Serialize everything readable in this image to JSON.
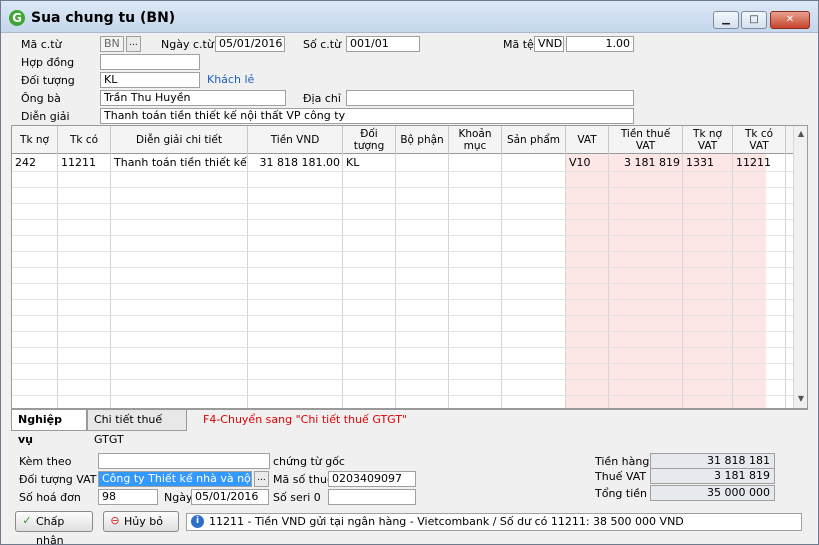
{
  "window": {
    "title": "Sua chung tu (BN)",
    "controls": {
      "minimize": "▁",
      "maximize": "□",
      "close": "✕"
    }
  },
  "header": {
    "ma_ct_label": "Mã c.từ",
    "ma_ct_value": "BN",
    "ma_ct_btn": "...",
    "ngay_ct_label": "Ngày c.từ",
    "ngay_ct_value": "05/01/2016",
    "so_ct_label": "Số c.từ",
    "so_ct_value": "001/01",
    "ma_te_label": "Mã tệ",
    "ma_te_value": "VND",
    "ty_gia_value": "1.00",
    "hop_dong_label": "Hợp đồng",
    "hop_dong_value": "",
    "doi_tuong_label": "Đối tượng",
    "doi_tuong_value": "KL",
    "doi_tuong_link": "Khách lẻ",
    "ong_ba_label": "Ông bà",
    "ong_ba_value": "Trần Thu Huyền",
    "dia_chi_label": "Địa chỉ",
    "dia_chi_value": "",
    "dien_giai_label": "Diễn giải",
    "dien_giai_value": "Thanh toán tiền thiết kế nội thất VP công ty"
  },
  "grid": {
    "columns": [
      "Tk nợ",
      "Tk có",
      "Diễn giải chi tiết",
      "Tiền VND",
      "Đối tượng",
      "Bộ phận",
      "Khoản mục",
      "Sản phẩm",
      "VAT",
      "Tiền thuế VAT",
      "Tk nợ VAT",
      "Tk có VAT"
    ],
    "rows": [
      [
        "242",
        "11211",
        "Thanh toán tiền thiết kế nội",
        "31 818 181.00",
        "KL",
        "",
        "",
        "",
        "V10",
        "3 181 819",
        "1331",
        "11211"
      ]
    ],
    "scroll_up": "▲",
    "scroll_down": "▼"
  },
  "tabs": {
    "items": [
      {
        "label": "Nghiệp vụ",
        "active": true
      },
      {
        "label": "Chi tiết thuế GTGT",
        "active": false
      }
    ],
    "hint": "F4-Chuyển sang \"Chi tiết thuế GTGT\""
  },
  "footer": {
    "kem_theo_label": "Kèm theo",
    "kem_theo_value": "",
    "chung_tu_goc_label": "chứng từ gốc",
    "doi_tuong_vat_label": "Đối tượng VAT",
    "doi_tuong_vat_value": "Công ty Thiết kế nhà và nội thất",
    "doi_tuong_vat_btn": "...",
    "ma_so_thue_label": "Mã số thuế",
    "ma_so_thue_value": "0203409097",
    "so_hoa_don_label": "Số hoá đơn",
    "so_hoa_don_value": "98",
    "ngay_label": "Ngày",
    "ngay_value": "05/01/2016",
    "so_seri_label": "Số seri 0",
    "so_seri_value": "",
    "tien_hang_label": "Tiền hàng",
    "tien_hang_value": "31 818 181",
    "thue_vat_label": "Thuế VAT",
    "thue_vat_value": "3 181 819",
    "tong_tien_label": "Tổng tiền",
    "tong_tien_value": "35 000 000"
  },
  "buttons": {
    "accept": "Chấp nhận",
    "cancel": "Hủy bỏ"
  },
  "status": "11211 - Tiền VND gửi tại ngân hàng - Vietcombank / Số dư có 11211: 38 500 000 VND"
}
